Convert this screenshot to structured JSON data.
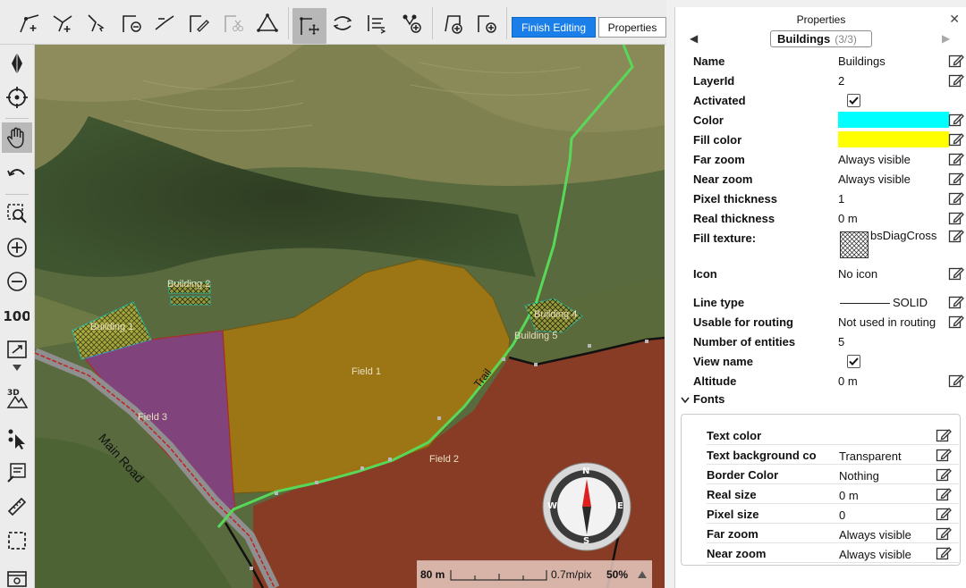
{
  "toolbar": {
    "finish_label": "Finish Editing",
    "properties_label": "Properties"
  },
  "map": {
    "labels": {
      "building1": "Building 1",
      "building2": "Building 2",
      "building4": "Building 4",
      "building5": "Building 5",
      "field1": "Field 1",
      "field2": "Field 2",
      "field3": "Field 3",
      "main_road": "Main Road",
      "trail": "Trail"
    },
    "compass": {
      "n": "N",
      "s": "S",
      "e": "E",
      "w": "W"
    },
    "scale": {
      "distance": "80 m",
      "resolution": "0.7m/pix",
      "zoom": "50%"
    }
  },
  "panel": {
    "title": "Properties",
    "layer_name": "Buildings",
    "layer_count": "(3/3)",
    "rows": [
      {
        "label": "Name",
        "value": "Buildings"
      },
      {
        "label": "LayerId",
        "value": "2"
      },
      {
        "label": "Activated",
        "value": ""
      },
      {
        "label": "Color",
        "value": ""
      },
      {
        "label": "Fill color",
        "value": ""
      },
      {
        "label": "Far zoom",
        "value": "Always visible"
      },
      {
        "label": "Near zoom",
        "value": "Always visible"
      },
      {
        "label": "Pixel thickness",
        "value": "1"
      },
      {
        "label": "Real thickness",
        "value": "0 m"
      },
      {
        "label": "Fill texture:",
        "value": "bsDiagCross"
      },
      {
        "label": "Icon",
        "value": "No icon"
      },
      {
        "label": "Line type",
        "value": "SOLID"
      },
      {
        "label": "Usable for routing",
        "value": "Not used in routing"
      },
      {
        "label": "Number of entities",
        "value": "5"
      },
      {
        "label": "View name",
        "value": ""
      },
      {
        "label": "Altitude",
        "value": "0 m"
      }
    ],
    "colors": {
      "line": "#00ffff",
      "fill": "#ffff00"
    },
    "fonts_header": "Fonts",
    "font_rows": [
      {
        "label": "Text color",
        "value": ""
      },
      {
        "label": "Text background co",
        "value": "Transparent"
      },
      {
        "label": "Border Color",
        "value": "Nothing"
      },
      {
        "label": "Real size",
        "value": "0 m"
      },
      {
        "label": "Pixel size",
        "value": "0"
      },
      {
        "label": "Far zoom",
        "value": "Always visible"
      },
      {
        "label": "Near zoom",
        "value": "Always visible"
      }
    ]
  }
}
